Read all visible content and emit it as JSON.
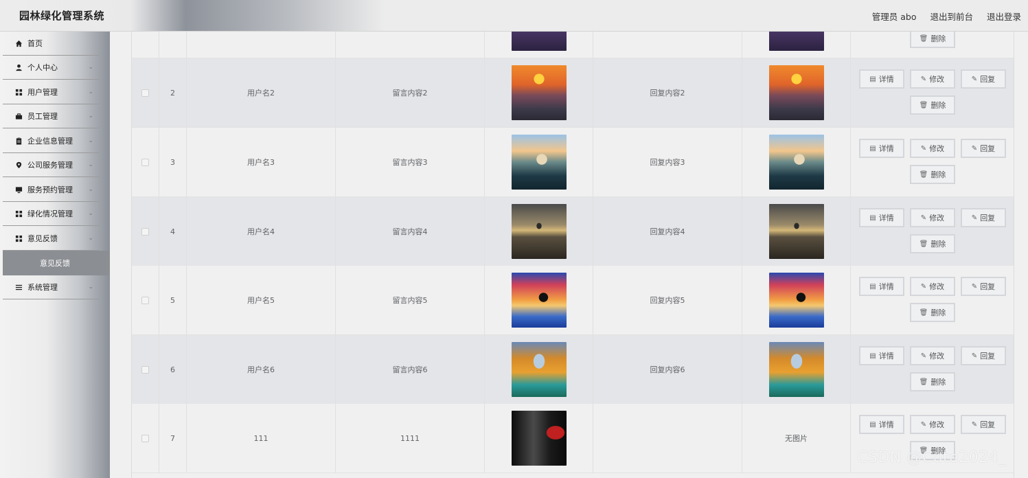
{
  "header": {
    "title": "园林绿化管理系统",
    "admin_label": "管理员 abo",
    "to_front_label": "退出到前台",
    "logout_label": "退出登录"
  },
  "sidebar": {
    "items": [
      {
        "label": "首页",
        "icon": "home-icon",
        "has_arrow": false
      },
      {
        "label": "个人中心",
        "icon": "person-icon",
        "has_arrow": true
      },
      {
        "label": "用户管理",
        "icon": "grid-icon",
        "has_arrow": true
      },
      {
        "label": "员工管理",
        "icon": "briefcase-icon",
        "has_arrow": true
      },
      {
        "label": "企业信息管理",
        "icon": "clipboard-icon",
        "has_arrow": true
      },
      {
        "label": "公司服务管理",
        "icon": "location-icon",
        "has_arrow": true
      },
      {
        "label": "服务预约管理",
        "icon": "monitor-icon",
        "has_arrow": true
      },
      {
        "label": "绿化情况管理",
        "icon": "grid-icon",
        "has_arrow": true
      },
      {
        "label": "意见反馈",
        "icon": "grid-icon",
        "has_arrow": true
      }
    ],
    "active_submenu": "意见反馈",
    "system_item": {
      "label": "系统管理",
      "icon": "list-icon",
      "has_arrow": true
    }
  },
  "table": {
    "partial_top_row": {
      "delete_label": "删除"
    },
    "rows": [
      {
        "index": "2",
        "username": "用户名2",
        "content": "留言内容2",
        "reply": "回复内容2",
        "image": "sunset-photo",
        "reply_image": "sunset-photo"
      },
      {
        "index": "3",
        "username": "用户名3",
        "content": "留言内容3",
        "reply": "回复内容3",
        "image": "castle-photo",
        "reply_image": "castle-photo"
      },
      {
        "index": "4",
        "username": "用户名4",
        "content": "留言内容4",
        "reply": "回复内容4",
        "image": "tree-photo",
        "reply_image": "tree-photo"
      },
      {
        "index": "5",
        "username": "用户名5",
        "content": "留言内容5",
        "reply": "回复内容5",
        "image": "dolphin-photo",
        "reply_image": "dolphin-photo"
      },
      {
        "index": "6",
        "username": "用户名6",
        "content": "留言内容6",
        "reply": "回复内容6",
        "image": "autumn-photo",
        "reply_image": "autumn-photo"
      },
      {
        "index": "7",
        "username": "111",
        "content": "1111",
        "reply": "",
        "image": "dark-photo",
        "reply_image": "无图片"
      }
    ],
    "actions": {
      "detail_label": "详情",
      "edit_label": "修改",
      "reply_label": "回复",
      "delete_label": "删除"
    }
  },
  "watermark": "CSDN @Cute2024_"
}
